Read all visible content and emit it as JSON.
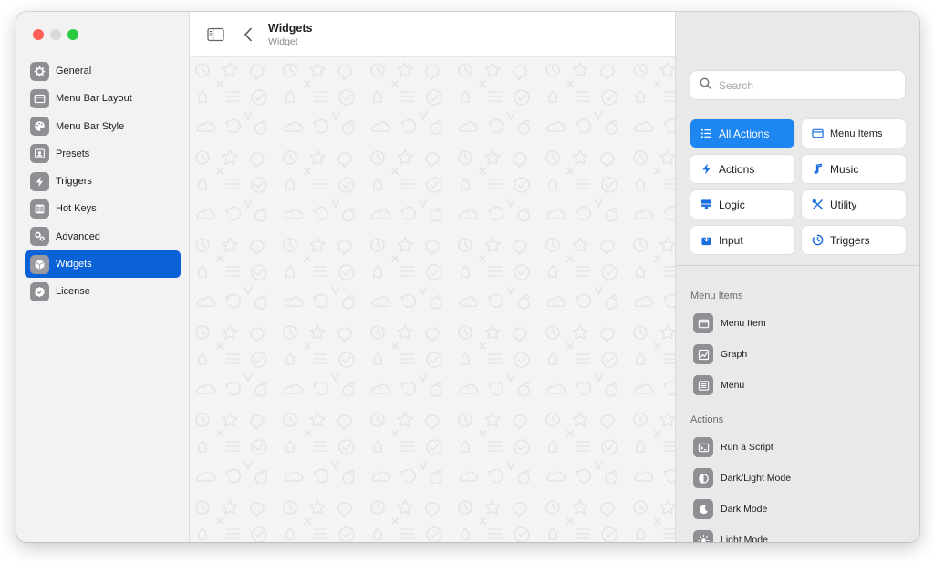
{
  "colors": {
    "close": "#ff5f57",
    "minimize": "#d9d9d9",
    "zoom": "#28c840",
    "accent_sidebar": "#0a62d6",
    "accent_button": "#1d86f0"
  },
  "sidebar": {
    "items": [
      {
        "label": "General",
        "icon": "gear-icon"
      },
      {
        "label": "Menu Bar Layout",
        "icon": "window-icon"
      },
      {
        "label": "Menu Bar Style",
        "icon": "palette-icon"
      },
      {
        "label": "Presets",
        "icon": "preset-icon"
      },
      {
        "label": "Triggers",
        "icon": "bolt-icon"
      },
      {
        "label": "Hot Keys",
        "icon": "command-icon"
      },
      {
        "label": "Advanced",
        "icon": "gears-icon"
      },
      {
        "label": "Widgets",
        "icon": "cube-icon",
        "selected": true
      },
      {
        "label": "License",
        "icon": "badge-check-icon"
      }
    ]
  },
  "toolbar": {
    "title": "Widgets",
    "subtitle": "Widget"
  },
  "library": {
    "search_placeholder": "Search",
    "categories": [
      {
        "label": "All Actions",
        "icon": "list-icon",
        "active": true
      },
      {
        "label": "Menu Items",
        "icon": "menu-window-icon"
      },
      {
        "label": "Actions",
        "icon": "bolt-icon"
      },
      {
        "label": "Music",
        "icon": "music-note-icon"
      },
      {
        "label": "Logic",
        "icon": "logic-icon"
      },
      {
        "label": "Utility",
        "icon": "tools-icon"
      },
      {
        "label": "Input",
        "icon": "input-tray-icon"
      },
      {
        "label": "Triggers",
        "icon": "timer-icon"
      }
    ],
    "sections": [
      {
        "title": "Menu Items",
        "items": [
          {
            "label": "Menu Item",
            "icon": "menu-window-icon"
          },
          {
            "label": "Graph",
            "icon": "graph-icon"
          },
          {
            "label": "Menu",
            "icon": "menu-list-icon"
          }
        ]
      },
      {
        "title": "Actions",
        "items": [
          {
            "label": "Run a Script",
            "icon": "terminal-icon"
          },
          {
            "label": "Dark/Light Mode",
            "icon": "half-circle-icon"
          },
          {
            "label": "Dark Mode",
            "icon": "moon-icon"
          },
          {
            "label": "Light Mode",
            "icon": "sun-icon"
          }
        ]
      }
    ]
  }
}
